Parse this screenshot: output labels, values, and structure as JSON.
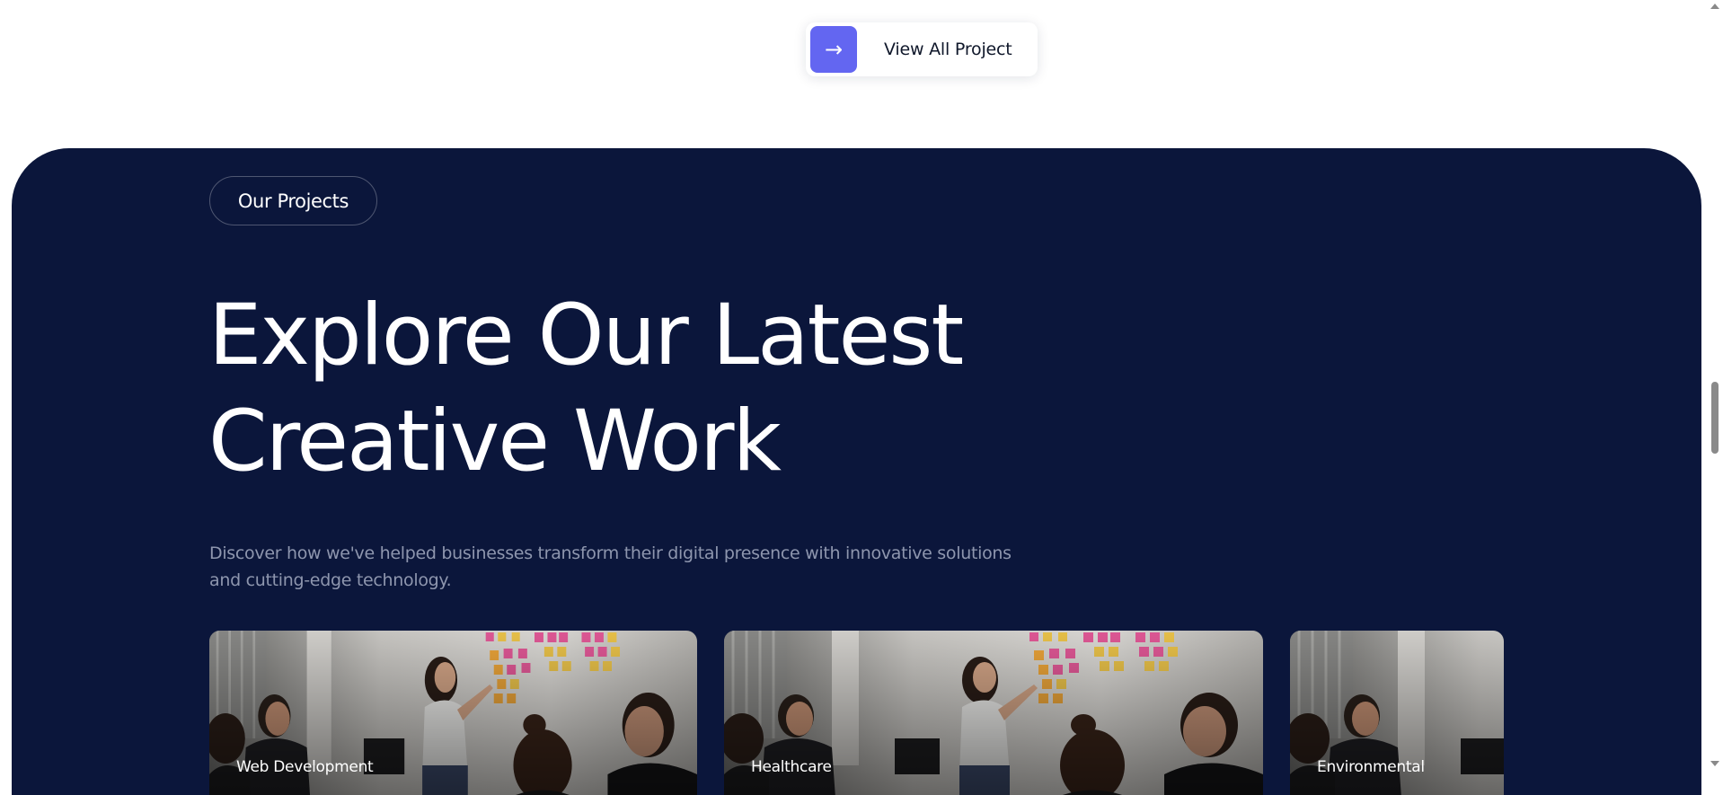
{
  "cta": {
    "arrow": "→",
    "label": "View All Project",
    "accent_color": "#6366f1"
  },
  "projects_section": {
    "background_color": "#0b163b",
    "badge": "Our Projects",
    "headline_line1": "Explore Our Latest",
    "headline_line2": "Creative Work",
    "description": "Discover how we've helped businesses transform their digital presence with innovative solutions and cutting-edge technology.",
    "cards": [
      {
        "category": "Web Development",
        "image": "team-meeting-sticky-notes-photo"
      },
      {
        "category": "Healthcare",
        "image": "team-meeting-sticky-notes-photo"
      },
      {
        "category": "Environmental",
        "image": "team-meeting-sticky-notes-photo"
      }
    ]
  },
  "scrollbar": {
    "icons": [
      "scroll-up-arrow-icon",
      "scroll-down-arrow-icon"
    ]
  }
}
